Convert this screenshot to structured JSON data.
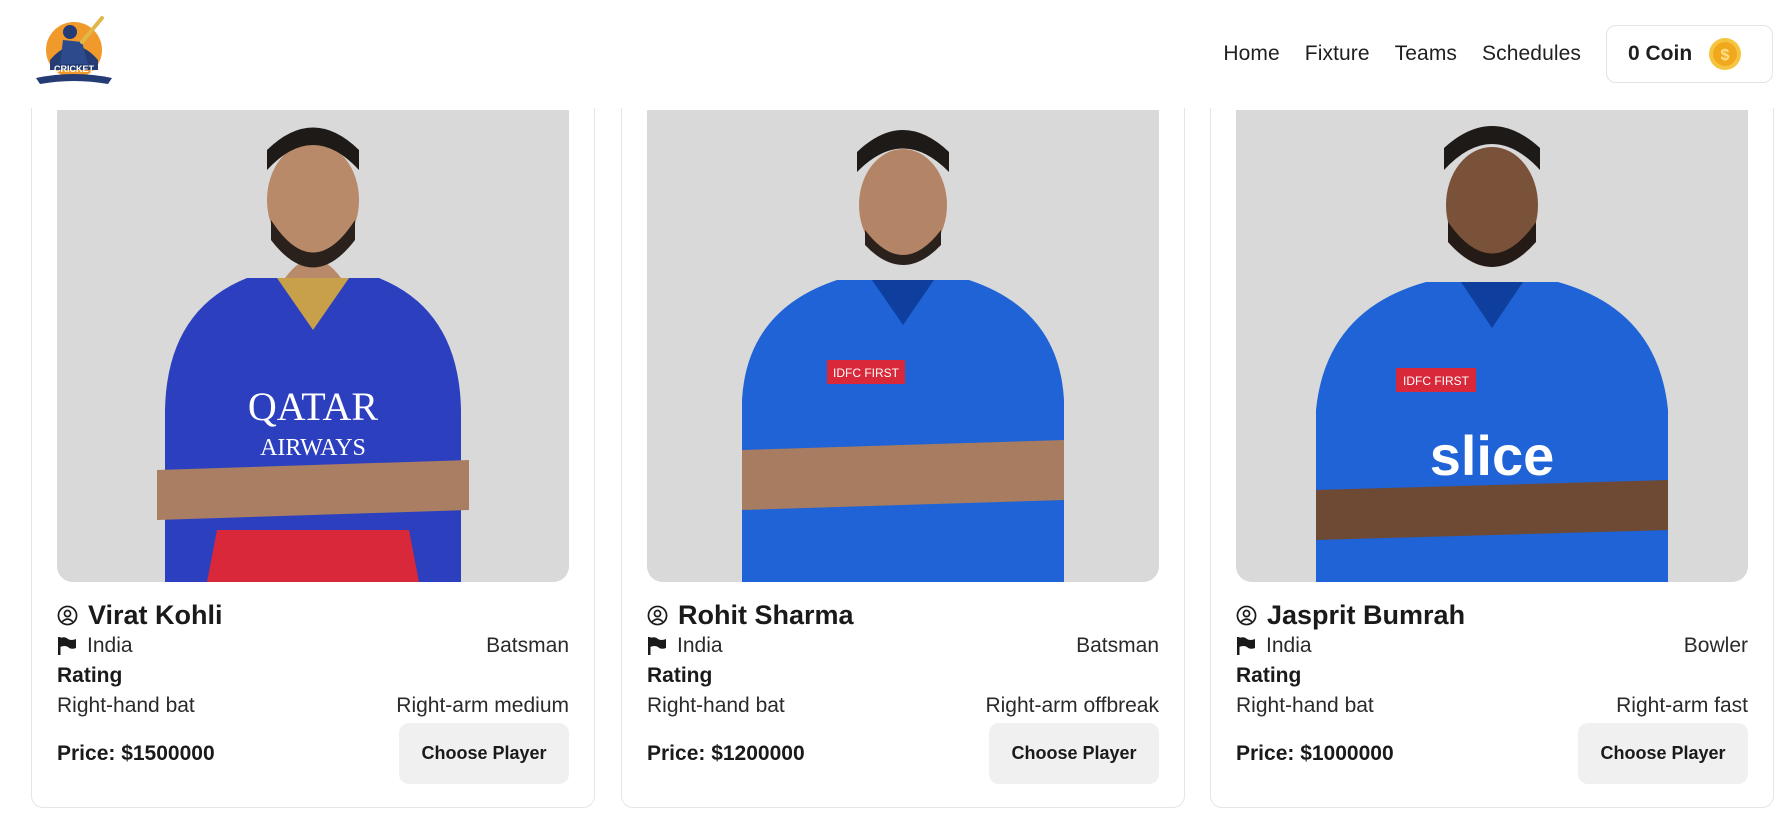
{
  "header": {
    "logo_text": "CRICKET",
    "nav": [
      "Home",
      "Fixture",
      "Teams",
      "Schedules"
    ],
    "coin_label": "0 Coin",
    "coin_symbol": "$"
  },
  "players": [
    {
      "name": "Virat Kohli",
      "country": "India",
      "role": "Batsman",
      "rating_label": "Rating",
      "batting": "Right-hand bat",
      "bowling": "Right-arm medium",
      "price": "Price: $1500000",
      "button": "Choose Player",
      "jersey_color": "#2b3fbf",
      "jersey_accent": "#d8283a",
      "jersey_texts": [
        "QATAR",
        "AIRWAYS"
      ]
    },
    {
      "name": "Rohit Sharma",
      "country": "India",
      "role": "Batsman",
      "rating_label": "Rating",
      "batting": "Right-hand bat",
      "bowling": "Right-arm offbreak",
      "price": "Price: $1200000",
      "button": "Choose Player",
      "jersey_color": "#1f63d6",
      "jersey_accent": "#1f63d6",
      "jersey_texts": [
        "IDFC FIRST",
        ""
      ]
    },
    {
      "name": "Jasprit Bumrah",
      "country": "India",
      "role": "Bowler",
      "rating_label": "Rating",
      "batting": "Right-hand bat",
      "bowling": "Right-arm fast",
      "price": "Price: $1000000",
      "button": "Choose Player",
      "jersey_color": "#1f63d6",
      "jersey_accent": "#1f63d6",
      "jersey_texts": [
        "IDFC FIRST",
        "slice"
      ]
    }
  ],
  "colors": {
    "photo_bg": "#d9d9d9",
    "button_bg": "#f0f0f0",
    "coin": "#f2a81d"
  }
}
